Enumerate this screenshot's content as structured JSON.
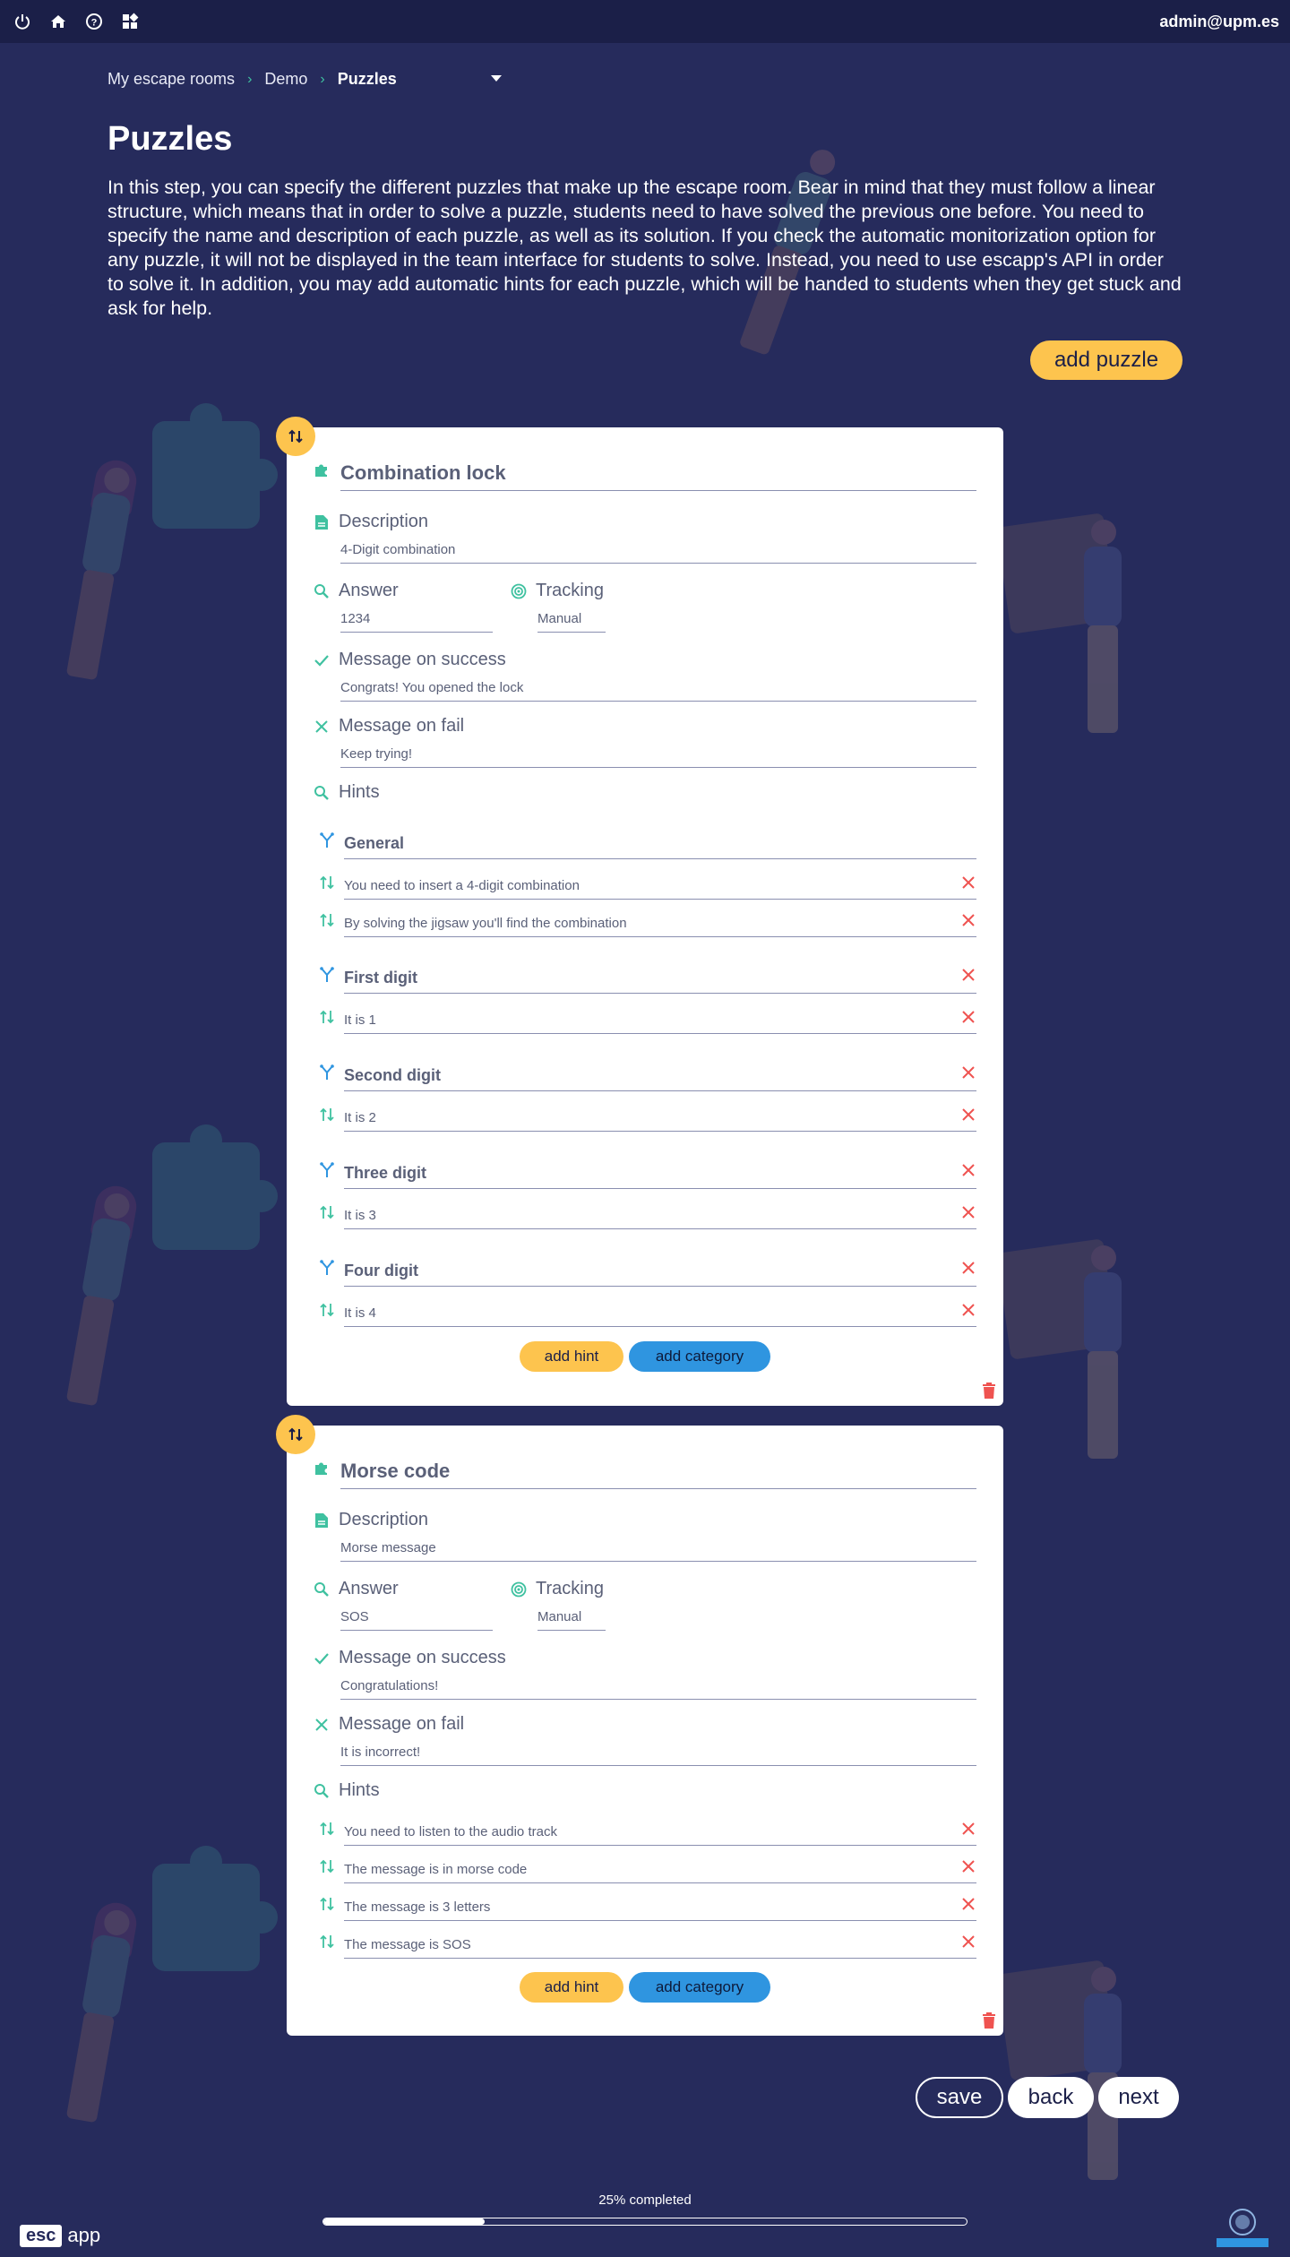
{
  "topbar": {
    "icons": [
      "power-icon",
      "home-icon",
      "help-icon",
      "apps-icon"
    ],
    "user": "admin@upm.es"
  },
  "breadcrumb": {
    "items": [
      "My escape rooms",
      "Demo"
    ],
    "current": "Puzzles"
  },
  "page": {
    "title": "Puzzles",
    "intro": "In this step, you can specify the different puzzles that make up the escape room. Bear in mind that they must follow a linear structure, which means that in order to solve a puzzle, students need to have solved the previous one before. You need to specify the name and description of each puzzle, as well as its solution. If you check the automatic monitorization option for any puzzle, it will not be displayed in the team interface for students to solve. Instead, you need to use escapp's API in order to solve it. In addition, you may add automatic hints for each puzzle, which will be handed to students when they get stuck and ask for help.",
    "add_puzzle": "add puzzle"
  },
  "labels": {
    "description": "Description",
    "answer": "Answer",
    "tracking": "Tracking",
    "success": "Message on success",
    "fail": "Message on fail",
    "hints": "Hints",
    "add_hint": "add hint",
    "add_category": "add category"
  },
  "puzzles": [
    {
      "title": "Combination lock",
      "description": "4-Digit combination",
      "answer": "1234",
      "tracking": "Manual",
      "success": "Congrats! You opened the lock",
      "fail": "Keep trying!",
      "categories": [
        {
          "name": "General",
          "hints": [
            "You need to insert a 4-digit combination",
            "By solving the jigsaw you'll find the combination"
          ]
        },
        {
          "name": "First digit",
          "hints": [
            "It is 1"
          ]
        },
        {
          "name": "Second digit",
          "hints": [
            "It is 2"
          ]
        },
        {
          "name": "Three digit",
          "hints": [
            "It is 3"
          ]
        },
        {
          "name": "Four digit",
          "hints": [
            "It is 4"
          ]
        }
      ]
    },
    {
      "title": "Morse code",
      "description": "Morse message",
      "answer": "SOS",
      "tracking": "Manual",
      "success": "Congratulations!",
      "fail": "It is incorrect!",
      "hints": [
        "You need to listen to the audio track",
        "The message is in morse code",
        "The message is 3 letters",
        "The message is SOS"
      ]
    }
  ],
  "footer": {
    "save": "save",
    "back": "back",
    "next": "next",
    "progress_label": "25% completed",
    "progress": 0.25,
    "logo_box": "esc",
    "logo_app": "app"
  },
  "colors": {
    "background": "#262b5c",
    "topbar": "#1b1f48",
    "accent_yellow": "#fdc44e",
    "accent_blue": "#2f95e0",
    "icon_green": "#3fc1a0",
    "delete_red": "#ef5350"
  }
}
